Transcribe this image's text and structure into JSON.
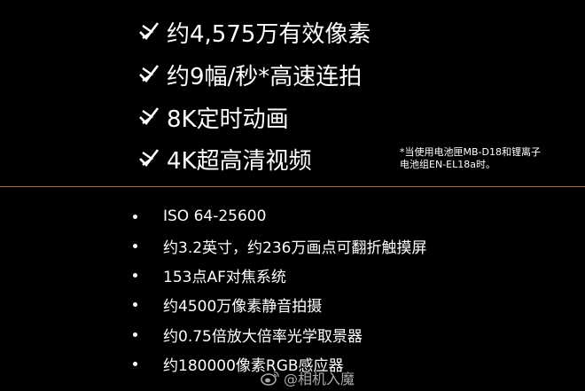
{
  "highlights": [
    {
      "text": "约4,575万有效像素"
    },
    {
      "text": "约9幅/秒*高速连拍"
    },
    {
      "text": "8K定时动画"
    },
    {
      "text": "4K超高清视频"
    }
  ],
  "footnote": {
    "line1": "*当使用电池匣MB-D18和锂离子",
    "line2": "电池组EN-EL18a时。"
  },
  "features": [
    {
      "text": "ISO 64-25600"
    },
    {
      "text": "约3.2英寸，约236万画点可翻折触摸屏"
    },
    {
      "text": "153点AF对焦系统"
    },
    {
      "text": "约4500万像素静音拍摄"
    },
    {
      "text": "约0.75倍放大倍率光学取景器"
    },
    {
      "text": "约180000像素RGB感应器"
    }
  ],
  "watermark": {
    "text": "@相机入魔",
    "icon": "weibo-logo-icon"
  },
  "colors": {
    "background": "#000000",
    "text": "#ffffff",
    "divider": "#a86a4a"
  }
}
